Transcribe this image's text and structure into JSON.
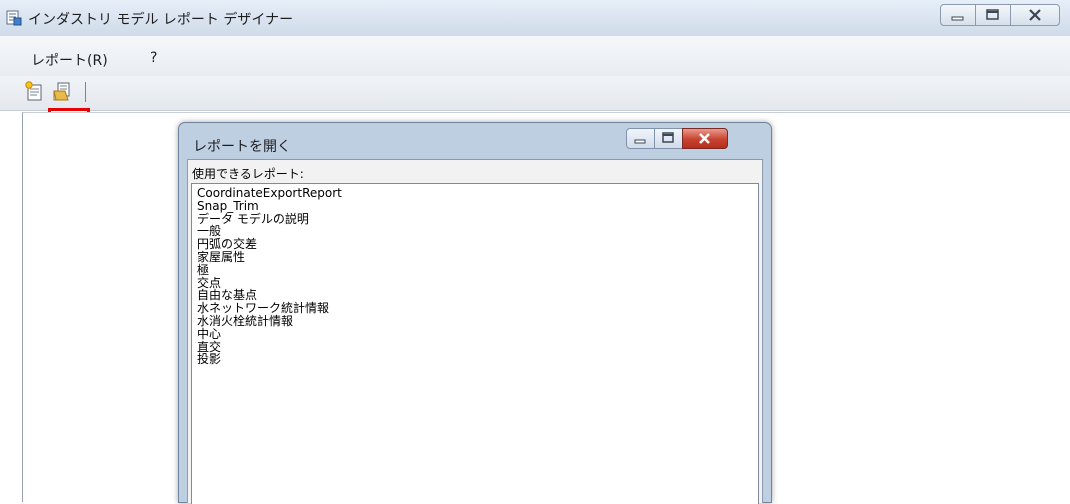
{
  "window": {
    "title": "インダストリ モデル レポート デザイナー"
  },
  "menubar": {
    "items": [
      {
        "label": "レポート(R)"
      },
      {
        "label": "?"
      }
    ]
  },
  "toolbar": {
    "buttons": [
      {
        "icon": "new-report-icon"
      },
      {
        "icon": "open-report-icon",
        "highlighted": true
      }
    ],
    "highlight_color": "#e60000"
  },
  "dialog": {
    "title": "レポートを開く",
    "list_label": "使用できるレポート:",
    "reports": [
      "CoordinateExportReport",
      "Snap_Trim",
      "データ モデルの説明",
      "一般",
      "円弧の交差",
      "家屋属性",
      "極",
      "交点",
      "自由な基点",
      "水ネットワーク統計情報",
      "水消火栓統計情報",
      "中心",
      "直交",
      "投影"
    ]
  },
  "colors": {
    "dialog_frame": "#bfcfe2",
    "close_button": "#c8422f"
  }
}
